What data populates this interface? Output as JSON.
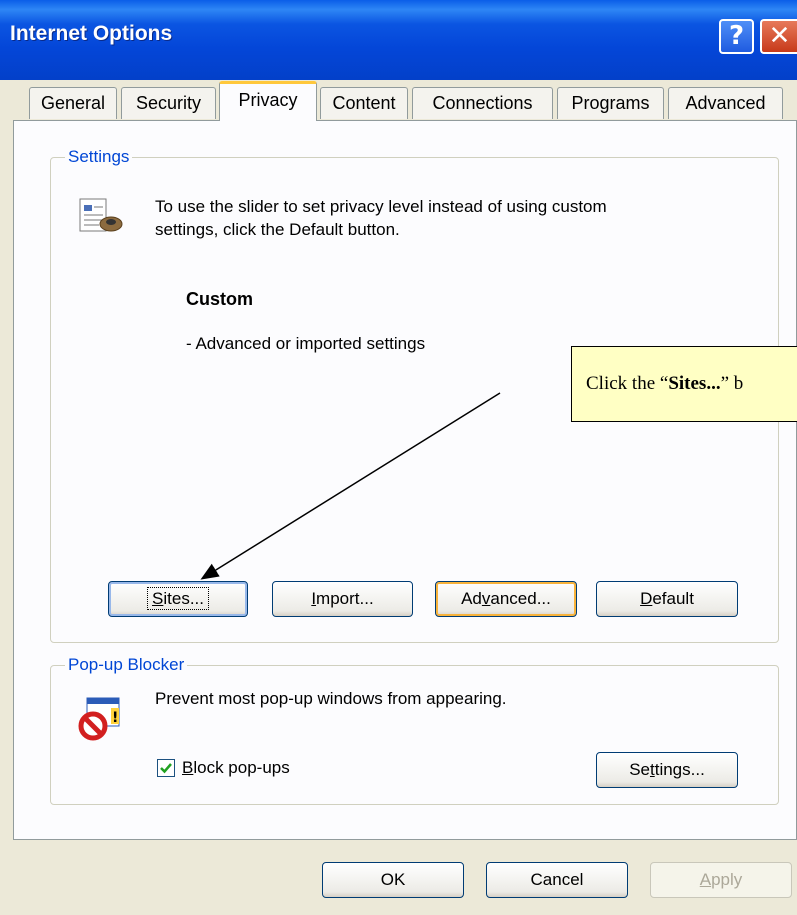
{
  "window": {
    "title": "Internet Options"
  },
  "titlebar": {
    "help_glyph": "?",
    "close_glyph": "✕"
  },
  "tabs": [
    {
      "label": "General",
      "active": false
    },
    {
      "label": "Security",
      "active": false
    },
    {
      "label": "Privacy",
      "active": true
    },
    {
      "label": "Content",
      "active": false
    },
    {
      "label": "Connections",
      "active": false
    },
    {
      "label": "Programs",
      "active": false
    },
    {
      "label": "Advanced",
      "active": false
    }
  ],
  "settings": {
    "group_title": "Settings",
    "icon": "privacy-settings-icon",
    "description_line1": "To use the slider to set privacy level instead of using custom",
    "description_line2": "settings, click the Default button.",
    "level_title": "Custom",
    "level_description": "- Advanced or imported settings",
    "buttons": {
      "sites": {
        "label": "Sites...",
        "mnemonic": "S",
        "rest": "ites..."
      },
      "import": {
        "label": "Import...",
        "mnemonic": "I",
        "rest": "mport..."
      },
      "advanced": {
        "label": "Advanced...",
        "pre": "Ad",
        "mnemonic": "v",
        "rest": "anced..."
      },
      "default": {
        "label": "Default",
        "mnemonic": "D",
        "rest": "efault"
      }
    }
  },
  "popup": {
    "group_title": "Pop-up Blocker",
    "icon": "popup-blocker-icon",
    "description": "Prevent most pop-up windows from appearing.",
    "checkbox": {
      "checked": true,
      "mnemonic": "B",
      "rest": "lock pop-ups"
    },
    "settings_button": {
      "pre": "Se",
      "mnemonic": "t",
      "rest": "tings..."
    }
  },
  "footer": {
    "ok": "OK",
    "cancel": "Cancel",
    "apply": {
      "mnemonic": "A",
      "rest": "pply",
      "disabled": true
    }
  },
  "callout": {
    "pre": "Click the “",
    "bold": "Sites...",
    "post": "” b"
  },
  "colors": {
    "titlebar": "#0446d8",
    "group_title": "#0046d5",
    "active_tab_accent": "#ffc83c",
    "callout_bg": "#ffffc4"
  }
}
